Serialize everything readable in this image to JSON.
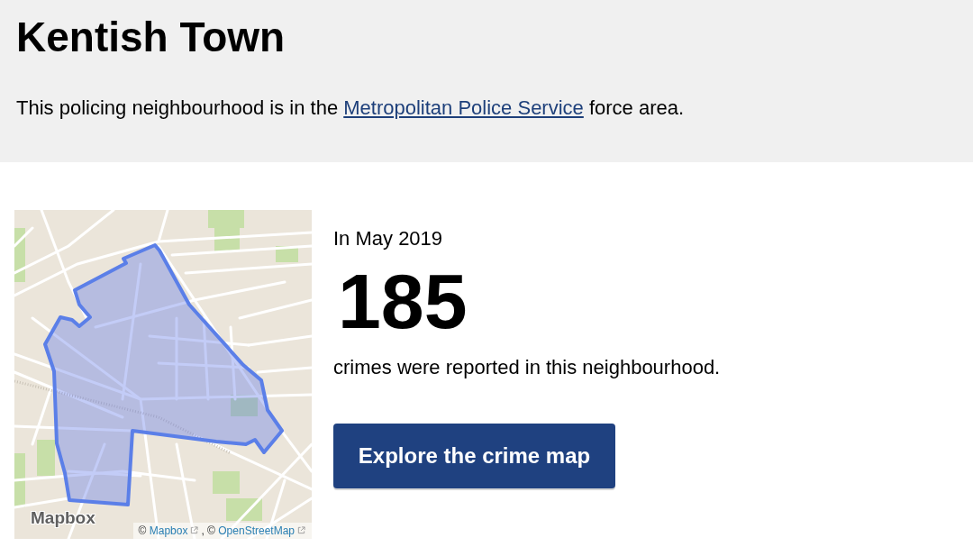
{
  "header": {
    "title": "Kentish Town",
    "intro": {
      "before": "This policing neighbourhood is in the ",
      "link": "Metropolitan Police Service",
      "after": " force area."
    }
  },
  "map": {
    "logo": "Mapbox",
    "attribution": [
      {
        "prefix": "©",
        "link": "Mapbox"
      },
      {
        "prefix": ", ©",
        "link": "OpenStreetMap"
      }
    ]
  },
  "summary": {
    "period": "In May 2019",
    "count": "185",
    "caption": "crimes were reported in this neighbourhood."
  },
  "button": {
    "label": "Explore the crime map"
  }
}
